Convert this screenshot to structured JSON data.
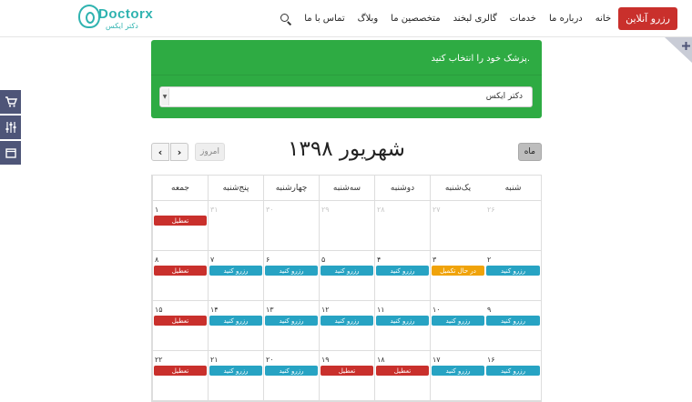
{
  "header": {
    "logo_text": "Doctorx",
    "logo_sub": "دکتر ایکس",
    "reserve_button": "رزرو آنلاین",
    "nav": [
      "خانه",
      "درباره ما",
      "خدمات",
      "گالری لبخند",
      "متخصصین ما",
      "وبلاگ",
      "تماس با ما"
    ]
  },
  "doctor_panel": {
    "label": "پزشک خود را انتخاب کنید.",
    "selected_doctor": "دکتر ایکس"
  },
  "calendar": {
    "title": "شهریور ۱۳۹۸",
    "month_button": "ماه",
    "today_button": "امروز",
    "prev_label": "‹",
    "next_label": "›",
    "weekdays": [
      "شنبه",
      "یک‌شنبه",
      "دوشنبه",
      "سه‌شنبه",
      "چهارشنبه",
      "پنج‌شنبه",
      "جمعه"
    ],
    "weeks": [
      [
        {
          "day": "۲۶",
          "other": true,
          "event": null
        },
        {
          "day": "۲۷",
          "other": true,
          "event": null
        },
        {
          "day": "۲۸",
          "other": true,
          "event": null
        },
        {
          "day": "۲۹",
          "other": true,
          "event": null
        },
        {
          "day": "۳۰",
          "other": true,
          "event": null
        },
        {
          "day": "۳۱",
          "other": true,
          "event": null
        },
        {
          "day": "۱",
          "other": false,
          "event": {
            "label": "تعطیل",
            "type": "holiday"
          }
        }
      ],
      [
        {
          "day": "۲",
          "other": false,
          "event": {
            "label": "رزرو کنید",
            "type": "reserve"
          }
        },
        {
          "day": "۳",
          "other": false,
          "event": {
            "label": "در حال تکمیل",
            "type": "pending"
          }
        },
        {
          "day": "۴",
          "other": false,
          "event": {
            "label": "رزرو کنید",
            "type": "reserve"
          }
        },
        {
          "day": "۵",
          "other": false,
          "event": {
            "label": "رزرو کنید",
            "type": "reserve"
          }
        },
        {
          "day": "۶",
          "other": false,
          "event": {
            "label": "رزرو کنید",
            "type": "reserve"
          }
        },
        {
          "day": "۷",
          "other": false,
          "event": {
            "label": "رزرو کنید",
            "type": "reserve"
          }
        },
        {
          "day": "۸",
          "other": false,
          "event": {
            "label": "تعطیل",
            "type": "holiday"
          }
        }
      ],
      [
        {
          "day": "۹",
          "other": false,
          "event": {
            "label": "رزرو کنید",
            "type": "reserve"
          }
        },
        {
          "day": "۱۰",
          "other": false,
          "event": {
            "label": "رزرو کنید",
            "type": "reserve"
          }
        },
        {
          "day": "۱۱",
          "other": false,
          "event": {
            "label": "رزرو کنید",
            "type": "reserve"
          }
        },
        {
          "day": "۱۲",
          "other": false,
          "event": {
            "label": "رزرو کنید",
            "type": "reserve"
          }
        },
        {
          "day": "۱۳",
          "other": false,
          "event": {
            "label": "رزرو کنید",
            "type": "reserve"
          }
        },
        {
          "day": "۱۴",
          "other": false,
          "event": {
            "label": "رزرو کنید",
            "type": "reserve"
          }
        },
        {
          "day": "۱۵",
          "other": false,
          "event": {
            "label": "تعطیل",
            "type": "holiday"
          }
        }
      ],
      [
        {
          "day": "۱۶",
          "other": false,
          "event": {
            "label": "رزرو کنید",
            "type": "reserve"
          }
        },
        {
          "day": "۱۷",
          "other": false,
          "event": {
            "label": "رزرو کنید",
            "type": "reserve"
          }
        },
        {
          "day": "۱۸",
          "other": false,
          "event": {
            "label": "تعطیل",
            "type": "holiday"
          }
        },
        {
          "day": "۱۹",
          "other": false,
          "event": {
            "label": "تعطیل",
            "type": "holiday"
          }
        },
        {
          "day": "۲۰",
          "other": false,
          "event": {
            "label": "رزرو کنید",
            "type": "reserve"
          }
        },
        {
          "day": "۲۱",
          "other": false,
          "event": {
            "label": "رزرو کنید",
            "type": "reserve"
          }
        },
        {
          "day": "۲۲",
          "other": false,
          "event": {
            "label": "تعطیل",
            "type": "holiday"
          }
        }
      ]
    ]
  },
  "side_tools": [
    "cart-icon",
    "sliders-icon",
    "layers-icon"
  ],
  "colors": {
    "green_panel": "#2eab43",
    "reserve": "#27a3c3",
    "holiday": "#c9302c",
    "pending": "#f0a30a",
    "side_tool": "#4e5578",
    "brand": "#2fb3b0"
  }
}
